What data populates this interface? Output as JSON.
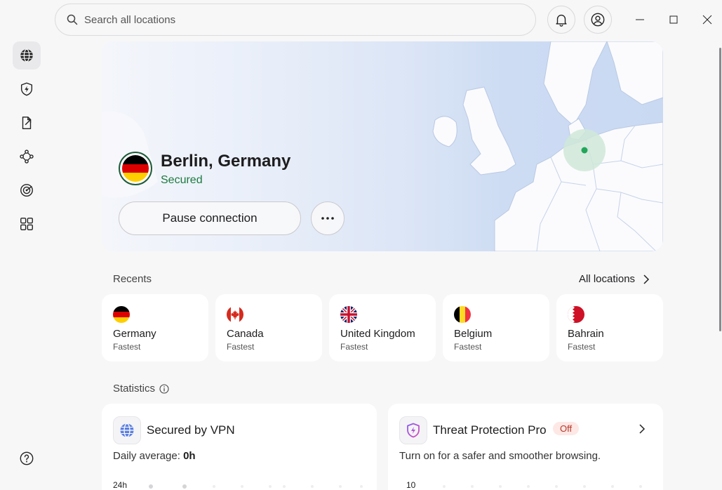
{
  "search": {
    "placeholder": "Search all locations"
  },
  "icons": {
    "search": "search-icon",
    "bell": "bell-icon",
    "profile": "profile-icon",
    "minimize": "minimize-icon",
    "maximize": "maximize-icon",
    "close": "close-icon"
  },
  "sidebar": {
    "items": [
      {
        "name": "globe",
        "active": true
      },
      {
        "name": "threat-protection"
      },
      {
        "name": "file-share"
      },
      {
        "name": "meshnet"
      },
      {
        "name": "dark-web-monitor"
      },
      {
        "name": "apps"
      }
    ],
    "help": "help-icon"
  },
  "connection": {
    "location": "Berlin, Germany",
    "status": "Secured",
    "pause_label": "Pause connection",
    "more_label": "···"
  },
  "recents": {
    "title": "Recents",
    "all_locations": "All locations",
    "items": [
      {
        "name": "Germany",
        "sub": "Fastest",
        "flag": "de"
      },
      {
        "name": "Canada",
        "sub": "Fastest",
        "flag": "ca"
      },
      {
        "name": "United Kingdom",
        "sub": "Fastest",
        "flag": "gb"
      },
      {
        "name": "Belgium",
        "sub": "Fastest",
        "flag": "be"
      },
      {
        "name": "Bahrain",
        "sub": "Fastest",
        "flag": "bh"
      }
    ]
  },
  "statistics": {
    "title": "Statistics",
    "vpn": {
      "title": "Secured by VPN",
      "daily_label": "Daily average:",
      "daily_value": "0h",
      "axis_top": "24h"
    },
    "threat": {
      "title": "Threat Protection Pro",
      "badge": "Off",
      "desc": "Turn on for a safer and smoother browsing.",
      "axis_top": "10"
    }
  },
  "colors": {
    "secured": "#1b7a3e",
    "badge_bg": "#fde8e5",
    "badge_text": "#b3382a",
    "map_marker": "#22a65a"
  }
}
